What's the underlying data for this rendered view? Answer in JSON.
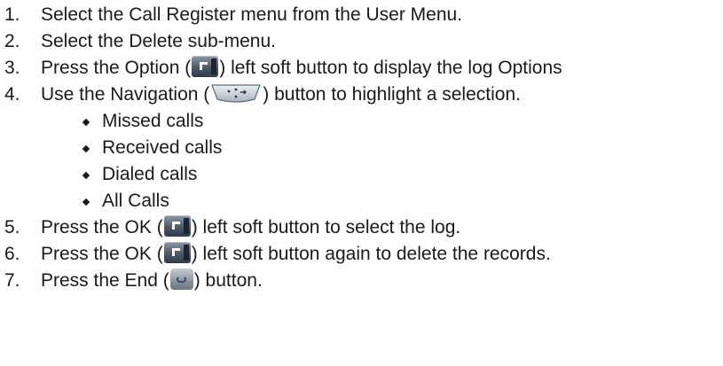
{
  "steps": [
    {
      "num": "1.",
      "text": "Select the Call Register menu from the User Menu."
    },
    {
      "num": "2.",
      "text": "Select the Delete sub-menu."
    },
    {
      "num": "3.",
      "pre": "Press the Option (",
      "post": ") left soft button to display the log Options",
      "icon": "left-soft-button-icon"
    },
    {
      "num": "4.",
      "pre": "Use the Navigation (",
      "post": ") button to highlight a selection.",
      "icon": "navigation-button-icon"
    },
    {
      "num": "5.",
      "pre": "Press the OK (",
      "post": ") left soft button to select the log.",
      "icon": "left-soft-button-icon"
    },
    {
      "num": "6.",
      "pre": "Press the OK (",
      "post": ") left soft button again to delete the records.",
      "icon": "left-soft-button-icon"
    },
    {
      "num": "7.",
      "pre": "Press the End (",
      "post": ") button.",
      "icon": "end-button-icon"
    }
  ],
  "options": [
    "Missed calls",
    "Received calls",
    "Dialed calls",
    "All Calls"
  ]
}
